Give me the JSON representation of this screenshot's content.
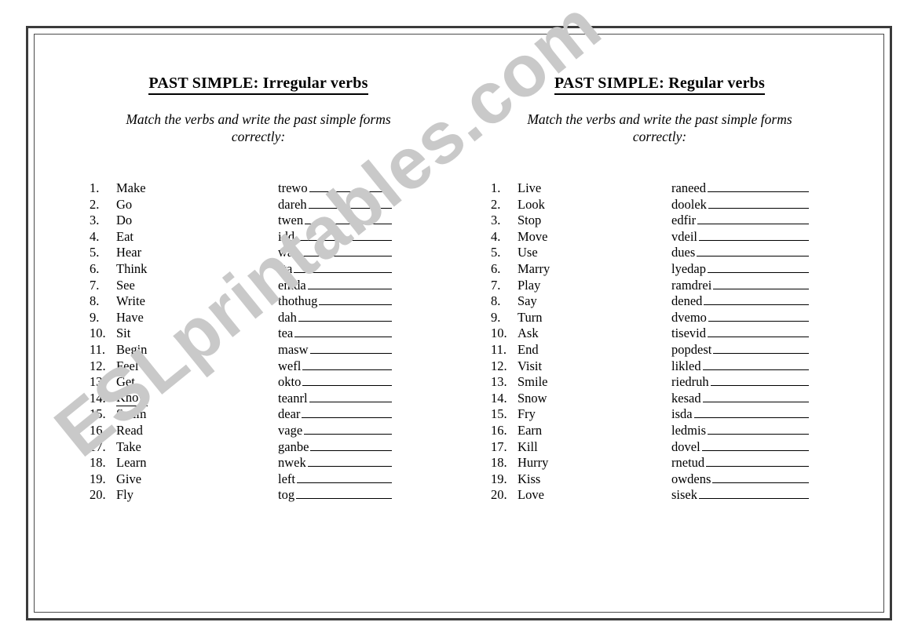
{
  "watermark": {
    "text": "ESLprintables.com"
  },
  "worksheets": [
    {
      "title": "PAST SIMPLE: Irregular verbs",
      "instruction": "Match the verbs and write the past simple forms correctly:",
      "verbs": [
        {
          "num": "1.",
          "word": "Make",
          "underlined": false
        },
        {
          "num": "2.",
          "word": "Go",
          "underlined": false
        },
        {
          "num": "3.",
          "word": "Do",
          "underlined": false
        },
        {
          "num": "4.",
          "word": "Eat",
          "underlined": false
        },
        {
          "num": "5.",
          "word": "Hear",
          "underlined": false
        },
        {
          "num": "6.",
          "word": "Think",
          "underlined": false
        },
        {
          "num": "7.",
          "word": "See",
          "underlined": false
        },
        {
          "num": "8.",
          "word": "Write",
          "underlined": false
        },
        {
          "num": "9.",
          "word": "Have",
          "underlined": false
        },
        {
          "num": "10.",
          "word": "Sit",
          "underlined": false
        },
        {
          "num": "11.",
          "word": "Begin",
          "underlined": false
        },
        {
          "num": "12.",
          "word": "Feel",
          "underlined": false
        },
        {
          "num": "13.",
          "word": "Get",
          "underlined": false
        },
        {
          "num": "14.",
          "word": "Know",
          "underlined": true
        },
        {
          "num": "15.",
          "word": "Swim",
          "underlined": false
        },
        {
          "num": "16.",
          "word": "Read",
          "underlined": false
        },
        {
          "num": "17.",
          "word": "Take",
          "underlined": false
        },
        {
          "num": "18.",
          "word": "Learn",
          "underlined": false
        },
        {
          "num": "19.",
          "word": "Give",
          "underlined": false
        },
        {
          "num": "20.",
          "word": "Fly",
          "underlined": false
        }
      ],
      "scrambled": [
        "trewo",
        "dareh",
        "twen",
        "idd",
        "was",
        "sta",
        "emda",
        "thothug",
        "dah",
        "tea",
        "masw",
        "wefl",
        "okto",
        "teanrl",
        "dear",
        "vage",
        "ganbe",
        "nwek",
        "left",
        "tog"
      ]
    },
    {
      "title": "PAST SIMPLE: Regular verbs",
      "instruction": "Match the verbs and write the past simple forms correctly:",
      "verbs": [
        {
          "num": "1.",
          "word": "Live",
          "underlined": false
        },
        {
          "num": "2.",
          "word": "Look",
          "underlined": false
        },
        {
          "num": "3.",
          "word": "Stop",
          "underlined": false
        },
        {
          "num": "4.",
          "word": "Move",
          "underlined": false
        },
        {
          "num": "5.",
          "word": "Use",
          "underlined": false
        },
        {
          "num": "6.",
          "word": "Marry",
          "underlined": false
        },
        {
          "num": "7.",
          "word": "Play",
          "underlined": false
        },
        {
          "num": "8.",
          "word": "Say",
          "underlined": false
        },
        {
          "num": "9.",
          "word": "Turn",
          "underlined": false
        },
        {
          "num": "10.",
          "word": "Ask",
          "underlined": false
        },
        {
          "num": "11.",
          "word": "End",
          "underlined": false
        },
        {
          "num": "12.",
          "word": "Visit",
          "underlined": false
        },
        {
          "num": "13.",
          "word": "Smile",
          "underlined": false
        },
        {
          "num": "14.",
          "word": "Snow",
          "underlined": false
        },
        {
          "num": "15.",
          "word": "Fry",
          "underlined": false
        },
        {
          "num": "16.",
          "word": "Earn",
          "underlined": false
        },
        {
          "num": "17.",
          "word": "Kill",
          "underlined": false
        },
        {
          "num": "18.",
          "word": "Hurry",
          "underlined": false
        },
        {
          "num": "19.",
          "word": "Kiss",
          "underlined": false
        },
        {
          "num": "20.",
          "word": "Love",
          "underlined": false
        }
      ],
      "scrambled": [
        "raneed",
        "doolek",
        "edfir",
        "vdeil",
        "dues",
        "lyedap",
        "ramdrei",
        "dened",
        "dvemo",
        "tisevid",
        "popdest",
        "likled",
        "riedruh",
        "kesad",
        "isda",
        "ledmis",
        "dovel",
        "rnetud",
        "owdens",
        "sisek"
      ]
    }
  ]
}
